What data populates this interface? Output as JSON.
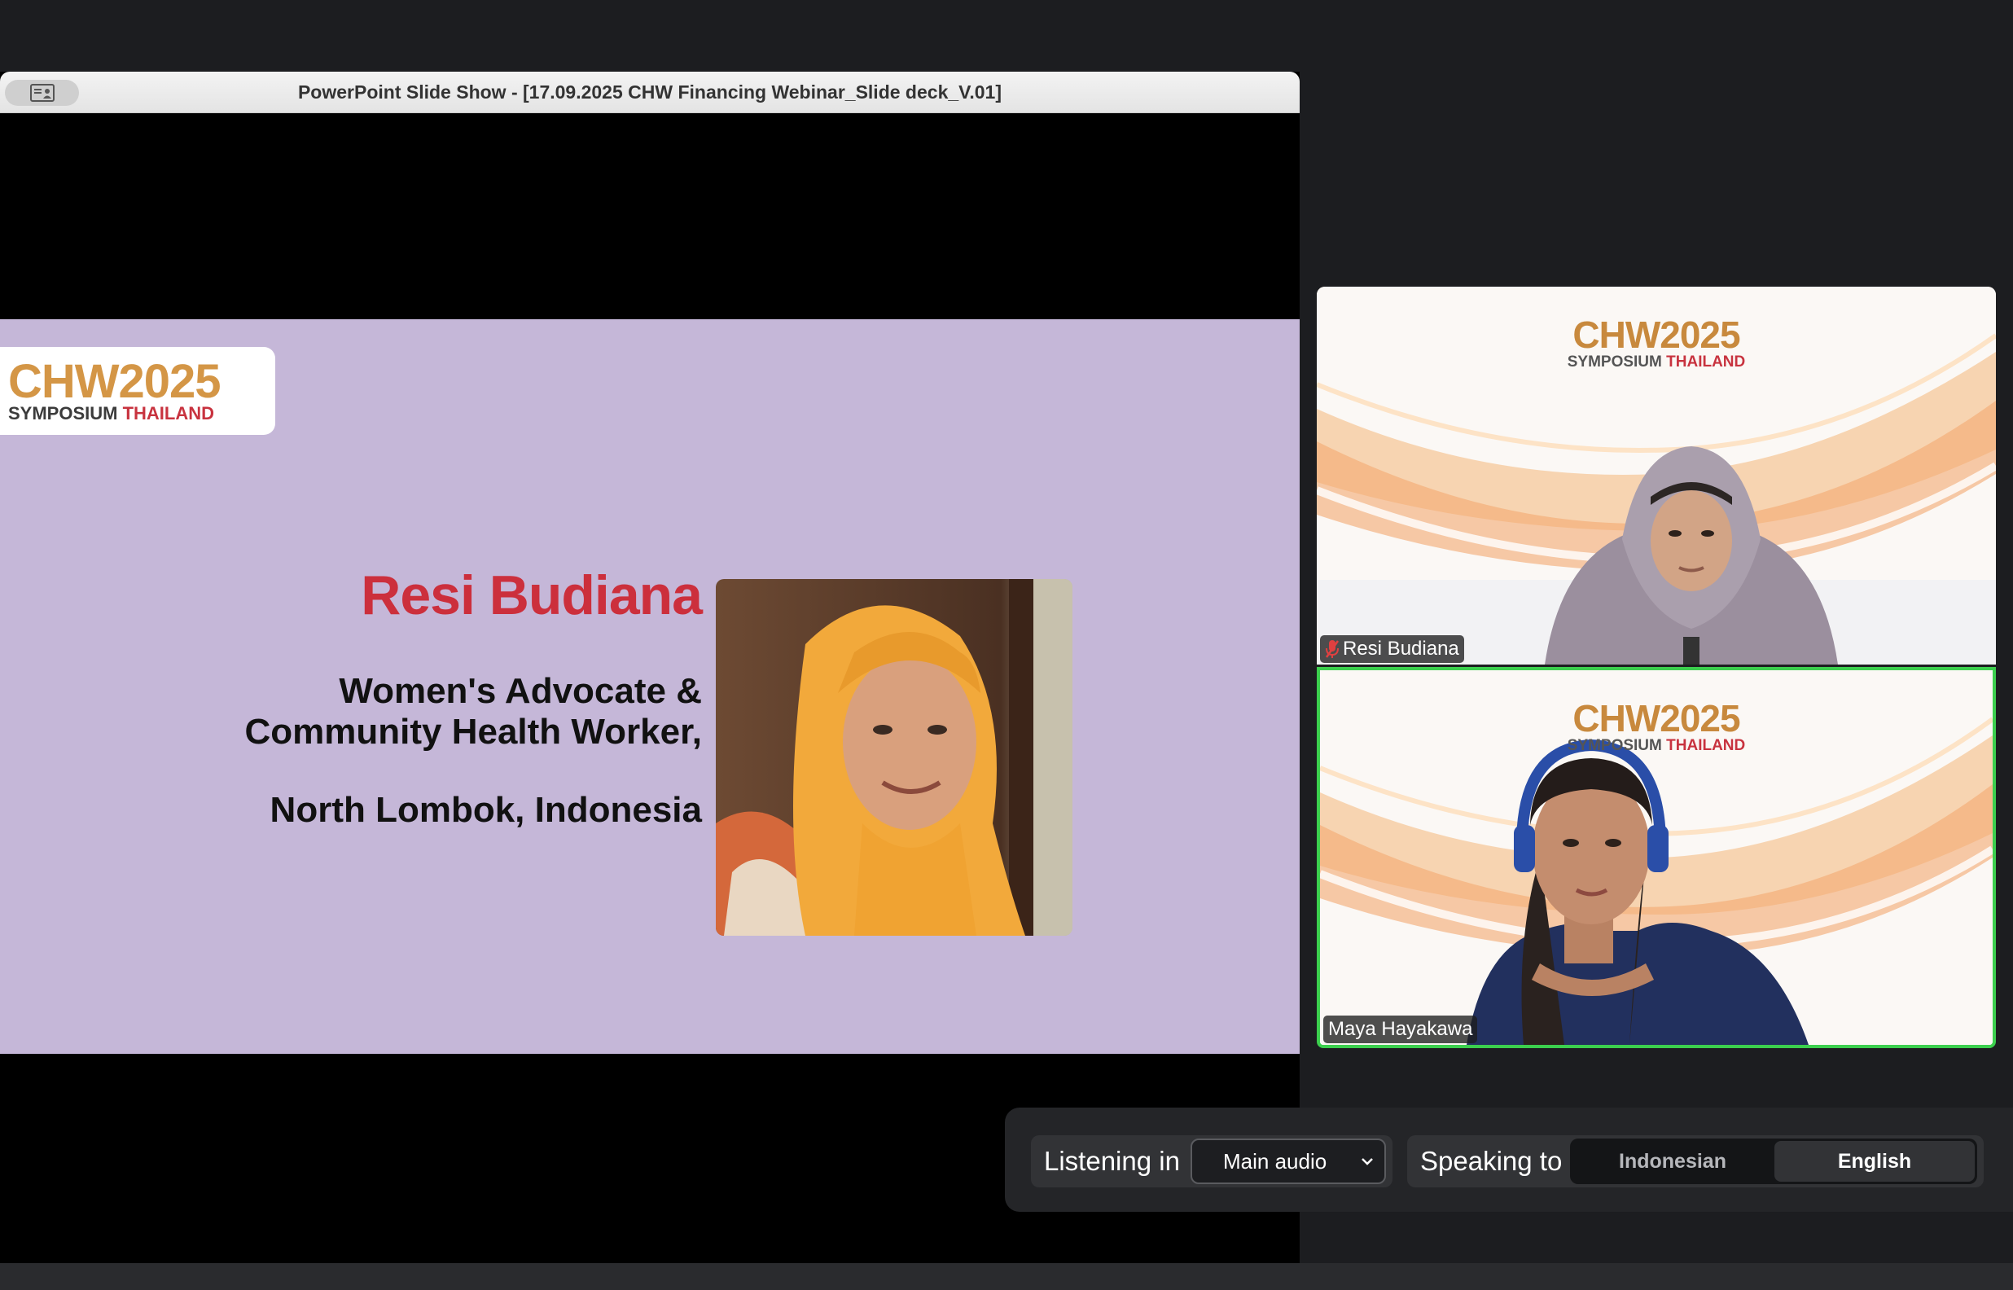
{
  "share": {
    "title": "PowerPoint Slide Show - [17.09.2025 CHW Financing Webinar_Slide deck_V.01]",
    "toggle_icon": "presenter-view-icon"
  },
  "slide": {
    "background": "#c5b7d8",
    "logo": {
      "line1_a": "CHW20",
      "line1_b": "25",
      "line2_a": "SYMPOSIUM ",
      "line2_b": "THAILAND"
    },
    "speaker_name": "Resi Budiana",
    "role_line1": "Women's Advocate &",
    "role_line2": "Community Health Worker,",
    "location": "North Lombok, Indonesia"
  },
  "participants": [
    {
      "name": "Resi Budiana",
      "muted": true,
      "mic_icon": "mic-muted-icon",
      "active_speaker": false
    },
    {
      "name": "Maya Hayakawa",
      "muted": false,
      "active_speaker": true,
      "highlight_color": "#3ccf4e"
    }
  ],
  "tile_logo": {
    "main": "CHW2025",
    "sub_a": "SYMPOSIUM ",
    "sub_b": "THAILAND"
  },
  "interpretation": {
    "listening_label": "Listening in",
    "audio_selected": "Main audio",
    "speaking_label": "Speaking to",
    "languages": [
      {
        "label": "Indonesian",
        "selected": false
      },
      {
        "label": "English",
        "selected": true
      }
    ]
  }
}
